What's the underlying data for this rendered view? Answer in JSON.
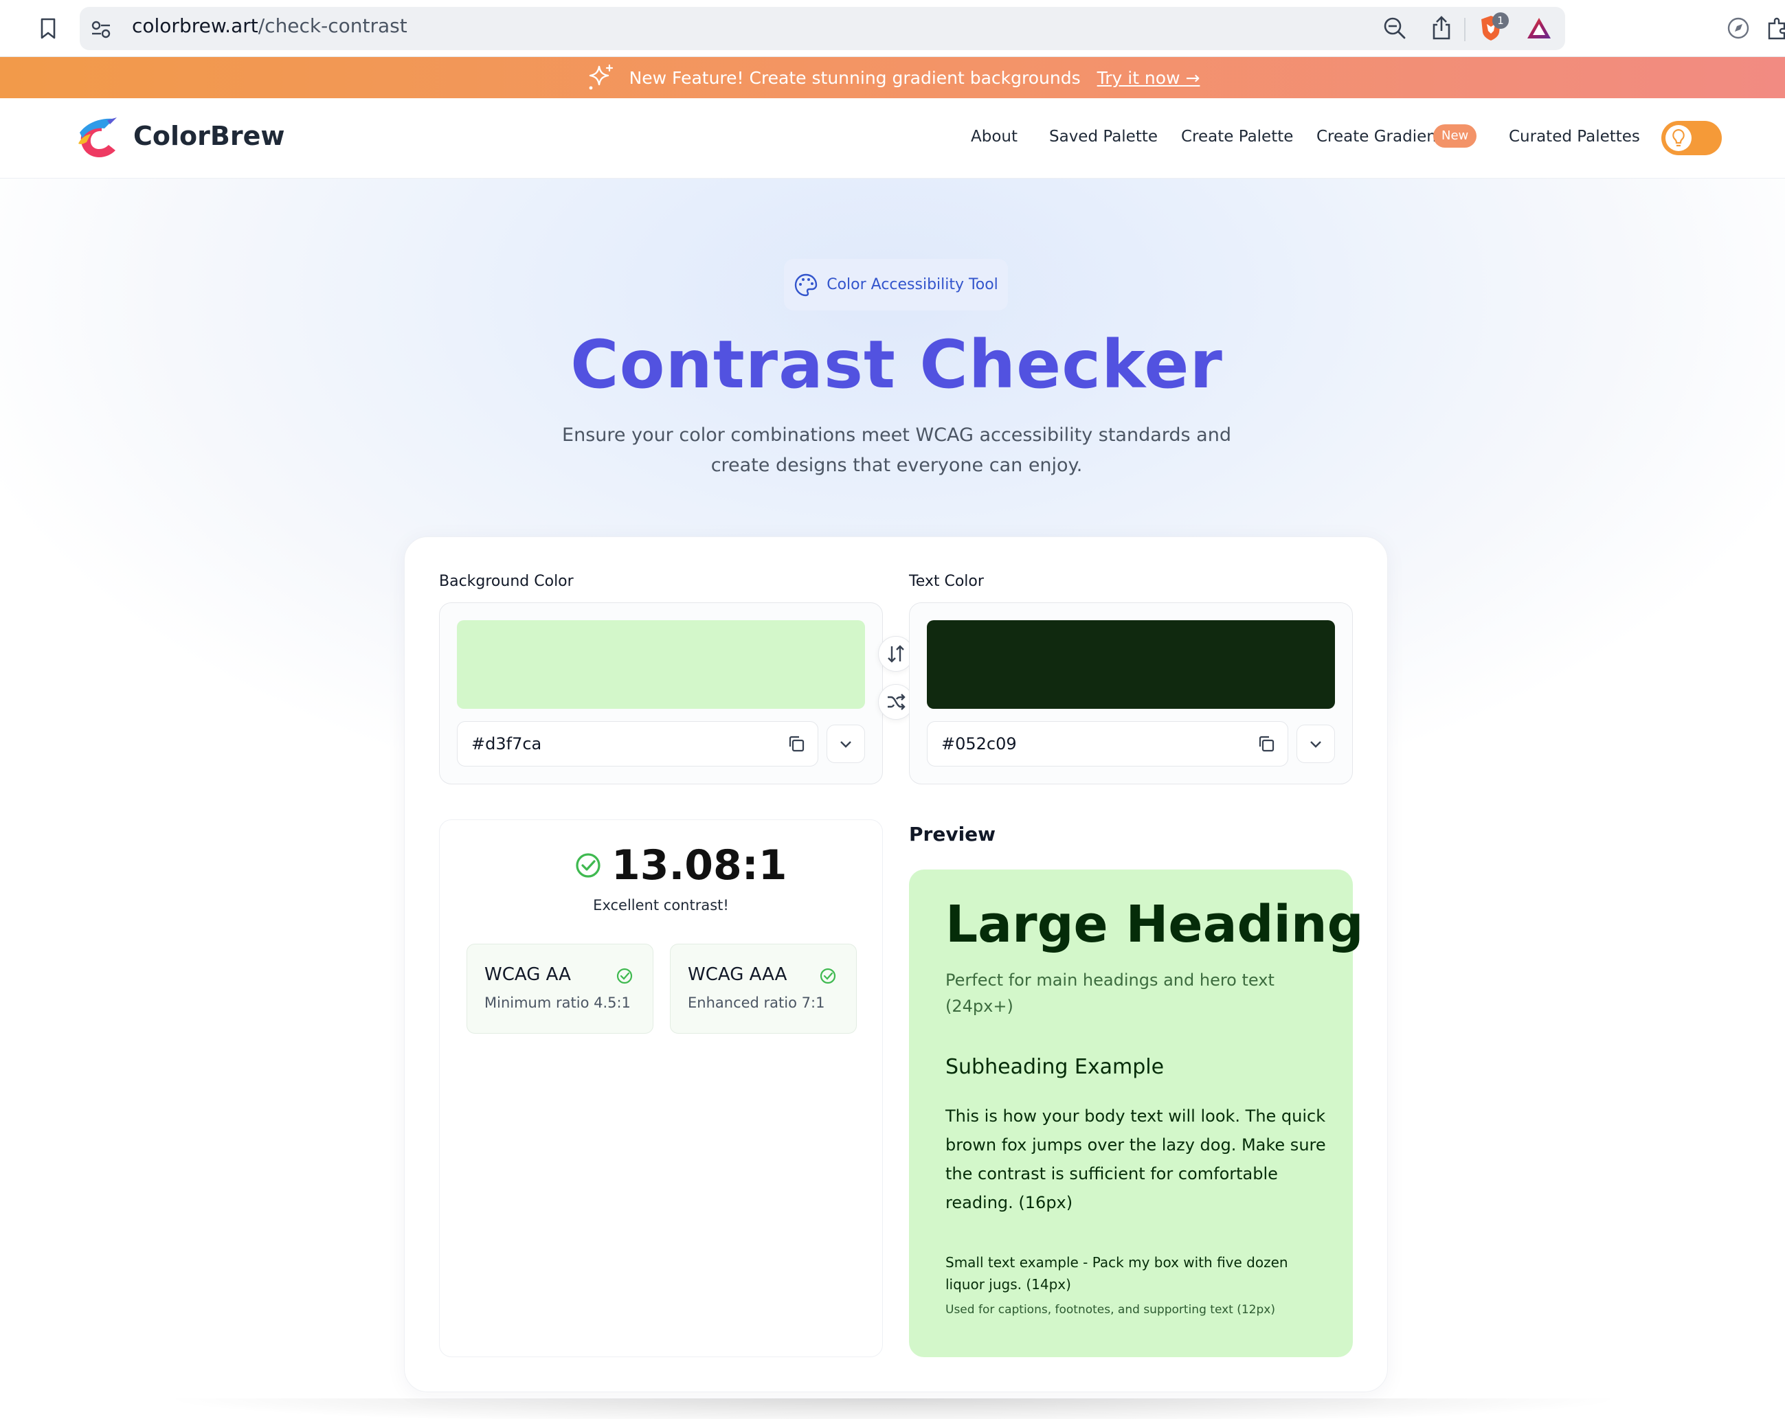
{
  "browser": {
    "url_host": "colorbrew.art",
    "url_path": "/check-contrast",
    "shield_count": "1",
    "icons": [
      "bookmark-icon",
      "site-settings-icon",
      "zoom-out-icon",
      "share-icon",
      "brave-shield-icon",
      "brave-rewards-icon",
      "leo-icon",
      "extensions-icon"
    ]
  },
  "announcement": {
    "text": "New Feature! Create stunning gradient backgrounds",
    "link": "Try it now →"
  },
  "header": {
    "brand": "ColorBrew",
    "nav": [
      "About",
      "Saved Palette",
      "Create Palette",
      "Create Gradient",
      "Curated Palettes"
    ],
    "new_badge": "New"
  },
  "hero": {
    "pill": "Color Accessibility Tool",
    "title": "Contrast Checker",
    "subtitle": "Ensure your color combinations meet WCAG accessibility standards and create designs that everyone can enjoy."
  },
  "background": {
    "label": "Background Color",
    "hex": "#d3f7ca",
    "swatch_color": "#d3f7ca"
  },
  "text_color": {
    "label": "Text Color",
    "hex": "#052c09",
    "swatch_color": "#10290f"
  },
  "result": {
    "ratio": "13.08:1",
    "note": "Excellent contrast!",
    "wcag_aa": {
      "title": "WCAG AA",
      "desc": "Minimum ratio 4.5:1"
    },
    "wcag_aaa": {
      "title": "WCAG AAA",
      "desc": "Enhanced ratio 7:1"
    }
  },
  "preview": {
    "label": "Preview",
    "heading": "Large Heading",
    "heading_note": "Perfect for main headings and hero text (24px+)",
    "subheading": "Subheading Example",
    "body": "This is how your body text will look. The quick brown fox jumps over the lazy dog. Make sure the contrast is sufficient for comfortable reading. (16px)",
    "small": "Small text example - Pack my box with five dozen liquor jugs. (14px)",
    "caption": "Used for captions, footnotes, and supporting text (12px)"
  },
  "colors": {
    "accent": "#5252e0",
    "banner_start": "#f29a4a",
    "banner_end": "#f28b82",
    "success": "#3fb950"
  }
}
